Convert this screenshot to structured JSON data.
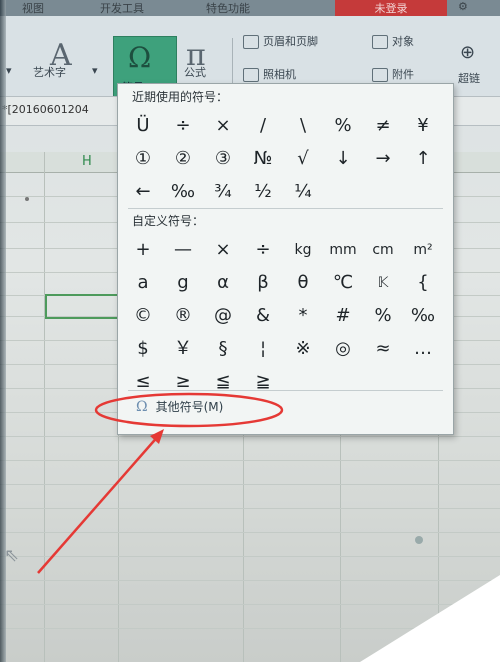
{
  "menubar": {
    "view": "视图",
    "dev": "开发工具",
    "special": "特色功能",
    "login": "未登录"
  },
  "ribbon": {
    "wordart": "艺术字",
    "symbol": "符号",
    "formula": "公式",
    "header_footer": "页眉和页脚",
    "object": "对象",
    "camera": "照相机",
    "attachment": "附件",
    "hyperlink": "超链"
  },
  "formula_bar": {
    "name_box": "*[20160601204"
  },
  "sheet": {
    "column_h": "H"
  },
  "symbol_panel": {
    "recent_title": "近期使用的符号：",
    "recent": [
      "Ü",
      "÷",
      "×",
      "/",
      "\\",
      "%",
      "≠",
      "¥",
      "①",
      "②",
      "③",
      "№",
      "√",
      "↓",
      "→",
      "↑",
      "←",
      "‰",
      "¾",
      "½",
      "¼"
    ],
    "custom_title": "自定义符号：",
    "custom": [
      "+",
      "—",
      "×",
      "÷",
      "kg",
      "mm",
      "cm",
      "m²",
      "a",
      "g",
      "α",
      "β",
      "θ",
      "℃",
      "𝕂",
      "{",
      "©",
      "®",
      "@",
      "&",
      "*",
      "#",
      "%",
      "‰",
      "$",
      "￥",
      "§",
      "¦",
      "※",
      "◎",
      "≈",
      "…",
      "≤",
      "≥",
      "≦",
      "≧"
    ],
    "more": "其他符号(M)"
  },
  "annotation": {
    "color": "#e53935"
  }
}
